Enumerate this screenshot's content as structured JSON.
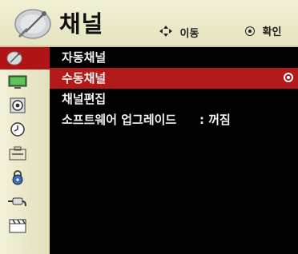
{
  "header": {
    "title": "채널",
    "hint_move_label": "이동",
    "hint_ok_label": "확인"
  },
  "sidebar": {
    "items": [
      {
        "name": "channel-satellite-icon",
        "active": true
      },
      {
        "name": "picture-tv-icon",
        "active": false
      },
      {
        "name": "audio-speaker-icon",
        "active": false
      },
      {
        "name": "time-clock-icon",
        "active": false
      },
      {
        "name": "option-toolbox-icon",
        "active": false
      },
      {
        "name": "lock-icon",
        "active": false
      },
      {
        "name": "input-cable-icon",
        "active": false
      },
      {
        "name": "media-clapper-icon",
        "active": false
      }
    ]
  },
  "menu": {
    "items": [
      {
        "label": "자동채널",
        "value": "",
        "selected": false
      },
      {
        "label": "수동채널",
        "value": "",
        "selected": true
      },
      {
        "label": "채널편집",
        "value": "",
        "selected": false
      },
      {
        "label": "소프트웨어 업그레이드",
        "value": ": 꺼짐",
        "selected": false
      }
    ]
  },
  "colors": {
    "header_bg": "#ede9c8",
    "highlight": "#b31b1b",
    "menu_bg": "#000000",
    "menu_text": "#f2f2f2"
  }
}
